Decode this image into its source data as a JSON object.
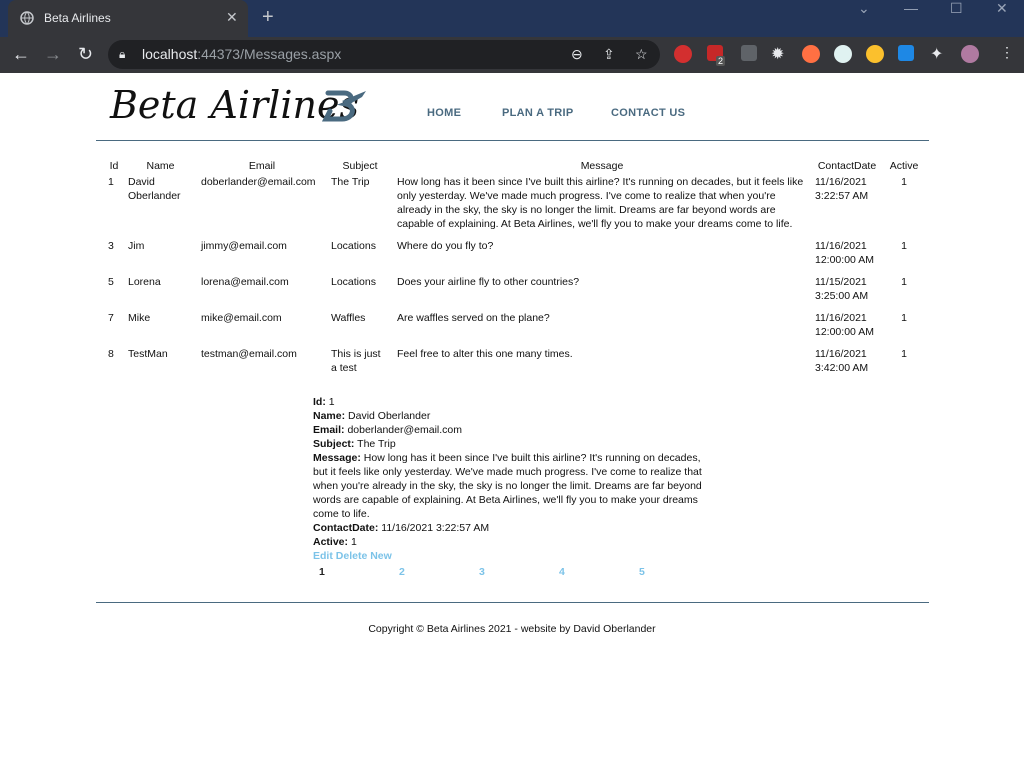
{
  "browser": {
    "tab_title": "Beta Airlines",
    "url_host": "localhost",
    "url_rest": ":44373/Messages.aspx",
    "ext_badge": "2"
  },
  "site": {
    "logo_text": "Beta Airlines",
    "nav": [
      "HOME",
      "PLAN A TRIP",
      "CONTACT US"
    ]
  },
  "table": {
    "headers": [
      "Id",
      "Name",
      "Email",
      "Subject",
      "Message",
      "ContactDate",
      "Active"
    ],
    "rows": [
      [
        "1",
        "David Oberlander",
        "doberlander@email.com",
        "The Trip",
        "How long has it been since I've built this airline? It's running on decades, but it feels like only yesterday. We've made much progress. I've come to realize that when you're already in the sky, the sky is no longer the limit. Dreams are far beyond words are capable of explaining. At Beta Airlines, we'll fly you to make your dreams come to life.",
        "11/16/2021 3:22:57 AM",
        "1"
      ],
      [
        "3",
        "Jim",
        "jimmy@email.com",
        "Locations",
        "Where do you fly to?",
        "11/16/2021 12:00:00 AM",
        "1"
      ],
      [
        "5",
        "Lorena",
        "lorena@email.com",
        "Locations",
        "Does your airline fly to other countries?",
        "11/15/2021 3:25:00 AM",
        "1"
      ],
      [
        "7",
        "Mike",
        "mike@email.com",
        "Waffles",
        "Are waffles served on the plane?",
        "11/16/2021 12:00:00 AM",
        "1"
      ],
      [
        "8",
        "TestMan",
        "testman@email.com",
        "This is just a test",
        "Feel free to alter this one many times.",
        "11/16/2021 3:42:00 AM",
        "1"
      ]
    ]
  },
  "detail": {
    "id_label": "Id:",
    "id": "1",
    "name_label": "Name:",
    "name": "David Oberlander",
    "email_label": "Email:",
    "email": "doberlander@email.com",
    "subject_label": "Subject:",
    "subject": "The Trip",
    "message_label": "Message:",
    "message": "How long has it been since I've built this airline? It's running on decades, but it feels like only yesterday. We've made much progress. I've come to realize that when you're already in the sky, the sky is no longer the limit. Dreams are far beyond words are capable of explaining. At Beta Airlines, we'll fly you to make your dreams come to life.",
    "date_label": "ContactDate:",
    "date": "11/16/2021 3:22:57 AM",
    "active_label": "Active:",
    "active": "1",
    "edit": "Edit",
    "delete": "Delete",
    "new": "New"
  },
  "pager": [
    "1",
    "2",
    "3",
    "4",
    "5"
  ],
  "footer": "Copyright © Beta Airlines 2021 - website by David Oberlander",
  "colors": {
    "link": "#7cc3e8",
    "nav": "#4a6a80",
    "chrome_tabbar": "#233558"
  }
}
